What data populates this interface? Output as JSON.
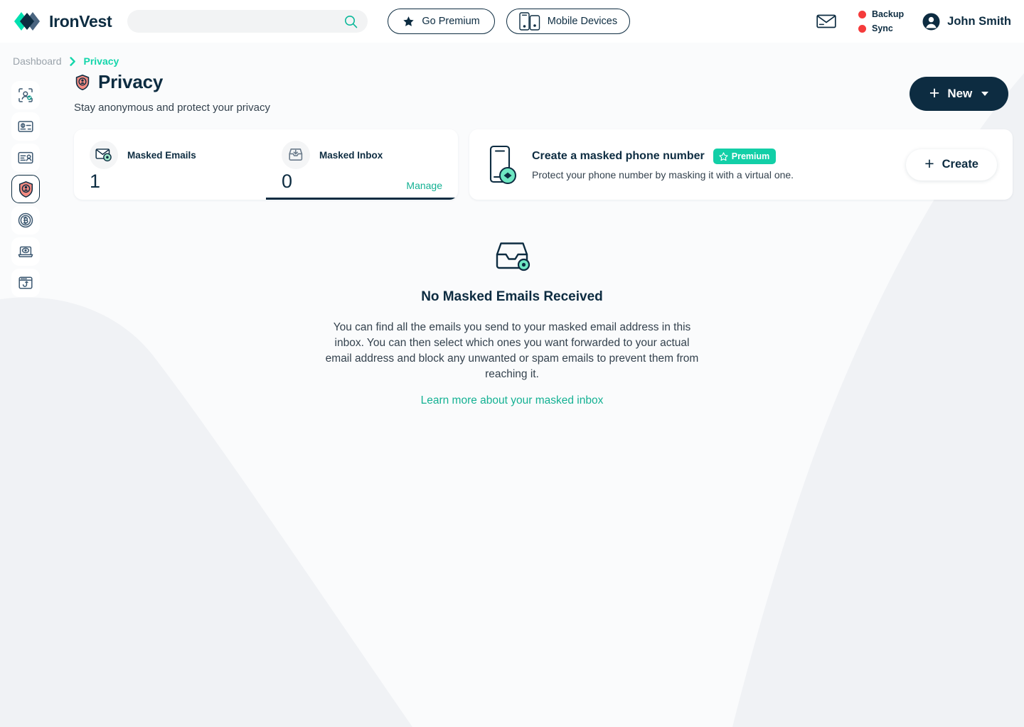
{
  "app": {
    "brand": "IronVest",
    "colors": {
      "navy": "#0d2c41",
      "teal": "#14d6ab",
      "teal_dark": "#14b193",
      "red": "#f53b3b",
      "salmon": "#f28b82",
      "page_bg": "#fafbfc"
    }
  },
  "header": {
    "search": {
      "value": "",
      "placeholder": ""
    },
    "go_premium_label": "Go Premium",
    "mobile_devices_label": "Mobile Devices",
    "statuses": [
      {
        "label": "Backup",
        "color": "#f53b3b"
      },
      {
        "label": "Sync",
        "color": "#f53b3b"
      }
    ],
    "user_name": "John Smith",
    "icons": {
      "search": "search-icon",
      "star": "star-icon",
      "mobile": "mobile-devices-icon",
      "mail": "mail-icon",
      "avatar": "avatar-icon"
    }
  },
  "breadcrumb": {
    "items": [
      {
        "label": "Dashboard",
        "active": false
      },
      {
        "label": "Privacy",
        "active": true
      }
    ],
    "separator": "›"
  },
  "sidebar": {
    "items": [
      {
        "name": "identity-protection",
        "icon": "person-scan-icon",
        "active": false
      },
      {
        "name": "cards",
        "icon": "credit-card-icon",
        "active": false
      },
      {
        "name": "ids",
        "icon": "id-card-icon",
        "active": false
      },
      {
        "name": "privacy",
        "icon": "shield-person-icon",
        "active": true
      },
      {
        "name": "crypto",
        "icon": "bitcoin-coin-icon",
        "active": false
      },
      {
        "name": "monitoring",
        "icon": "laptop-eye-icon",
        "active": false
      },
      {
        "name": "phishing",
        "icon": "browser-hook-icon",
        "active": false
      }
    ]
  },
  "main": {
    "page_title": "Privacy",
    "page_title_icon": "shield-person-icon",
    "page_subtitle": "Stay anonymous and protect your privacy",
    "new_button": {
      "label": "New",
      "plus": "+",
      "has_dropdown": true
    }
  },
  "stats": {
    "tabs": [
      {
        "label": "Masked Emails",
        "value": "1",
        "icon": "masked-email-icon",
        "active": false,
        "action_label": ""
      },
      {
        "label": "Masked Inbox",
        "value": "0",
        "icon": "masked-inbox-icon",
        "active": true,
        "action_label": "Manage"
      }
    ]
  },
  "promo": {
    "icon": "masked-phone-icon",
    "title": "Create a masked phone number",
    "badge": {
      "label": "Premium",
      "icon": "star-outline-icon",
      "color": "#12cfa7"
    },
    "description": "Protect your phone number by masking it with a virtual one.",
    "button": {
      "label": "Create",
      "plus": "+"
    }
  },
  "empty_state": {
    "icon": "inbox-check-icon",
    "title": "No Masked Emails Received",
    "body": "You can find all the emails you send to your masked email address in this inbox. You can then select which ones you want forwarded to your actual email address and block any unwanted or spam emails to prevent them from reaching it.",
    "link_label": "Learn more about your masked inbox"
  }
}
